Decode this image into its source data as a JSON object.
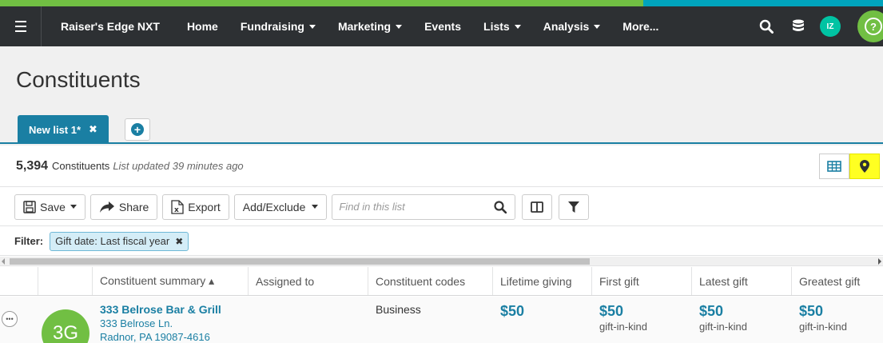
{
  "nav": {
    "brand": "Raiser's Edge NXT",
    "items": [
      {
        "label": "Home",
        "dropdown": false
      },
      {
        "label": "Fundraising",
        "dropdown": true
      },
      {
        "label": "Marketing",
        "dropdown": true
      },
      {
        "label": "Events",
        "dropdown": false
      },
      {
        "label": "Lists",
        "dropdown": true
      },
      {
        "label": "Analysis",
        "dropdown": true
      },
      {
        "label": "More...",
        "dropdown": false
      }
    ],
    "avatar_initials": "IZ",
    "help_label": "?"
  },
  "page": {
    "title": "Constituents"
  },
  "tabs": [
    {
      "label": "New list 1*",
      "close": "✖"
    }
  ],
  "summary": {
    "count": "5,394",
    "count_label": "Constituents",
    "updated": "List updated 39 minutes ago"
  },
  "toolbar": {
    "save": "Save",
    "share": "Share",
    "export": "Export",
    "add_exclude": "Add/Exclude",
    "search_placeholder": "Find in this list"
  },
  "filter": {
    "label": "Filter:",
    "chip": "Gift date: Last fiscal year",
    "chip_close": "✖"
  },
  "grid": {
    "columns": [
      "Constituent summary ▴",
      "Assigned to",
      "Constituent codes",
      "Lifetime giving",
      "First gift",
      "Latest gift",
      "Greatest gift"
    ],
    "rows": [
      {
        "initials": "3G",
        "name": "333 Belrose Bar & Grill",
        "address_line1": "333 Belrose Ln.",
        "address_line2": "Radnor, PA 19087-4616",
        "assigned_to": "",
        "codes": "Business",
        "lifetime": "$50",
        "first_gift": "$50",
        "first_gift_type": "gift-in-kind",
        "latest_gift": "$50",
        "latest_gift_type": "gift-in-kind",
        "greatest_gift": "$50",
        "greatest_gift_type": "gift-in-kind"
      }
    ]
  },
  "colors": {
    "navbar": "#2d3033",
    "accent_green": "#71bf43",
    "accent_blue": "#1a7fa3",
    "highlight_yellow": "#ffff22"
  },
  "icons": [
    "hamburger-icon",
    "search-icon",
    "database-icon",
    "help-icon",
    "add-tab-icon",
    "grid-view-icon",
    "map-pin-icon",
    "save-icon",
    "share-icon",
    "export-icon",
    "columns-icon",
    "filter-icon",
    "more-icon"
  ]
}
